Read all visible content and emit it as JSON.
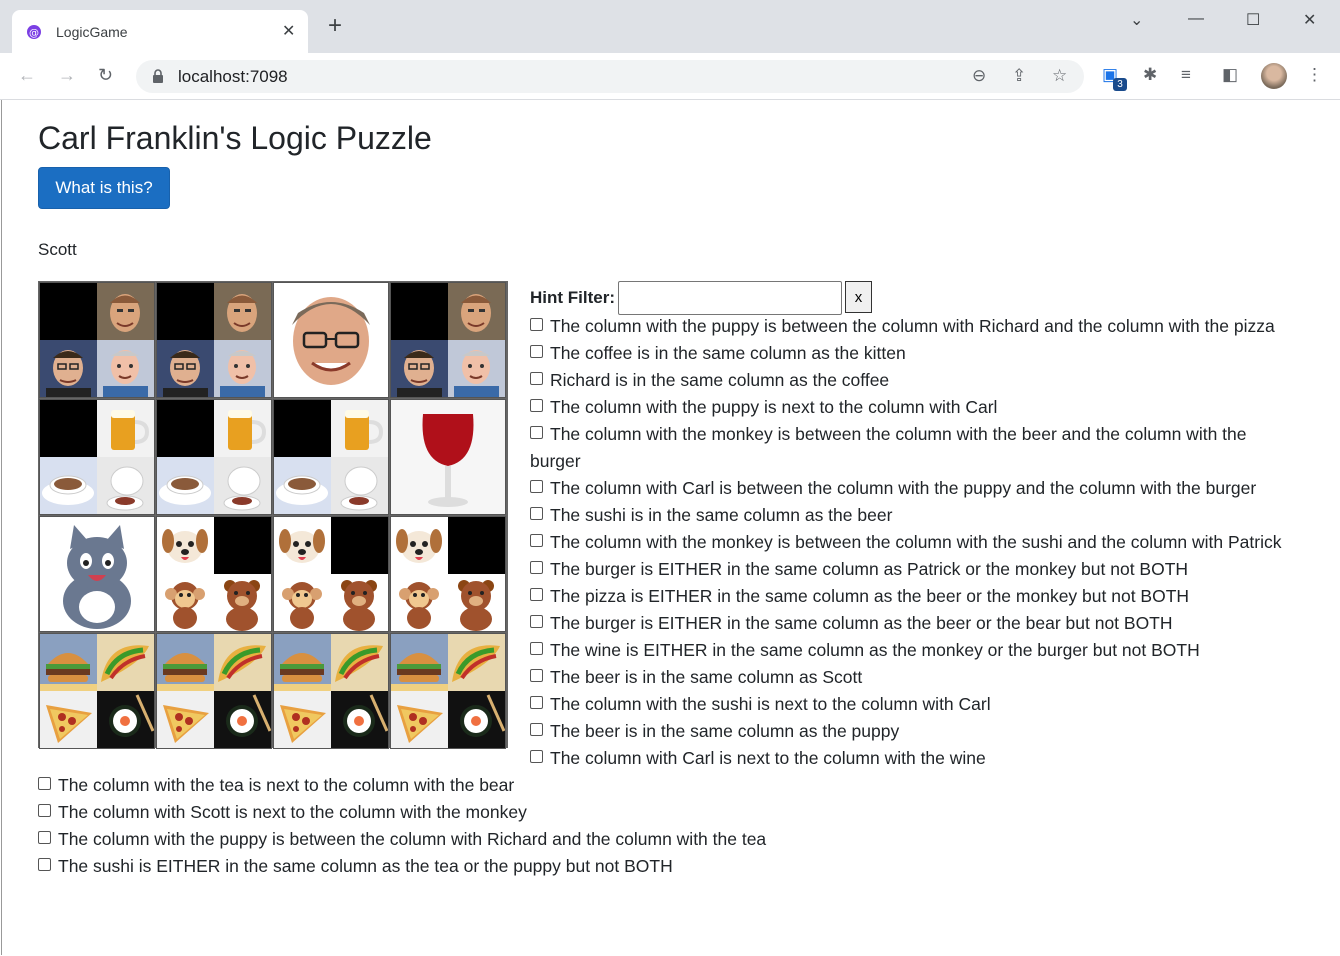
{
  "browser": {
    "tab_title": "LogicGame",
    "url": "localhost:7098",
    "extension_badge": "3"
  },
  "page": {
    "title": "Carl Franklin's Logic Puzzle",
    "what_button": "What is this?",
    "player": "Scott",
    "hint_filter_label": "Hint Filter:",
    "hint_filter_value": "",
    "hint_clear_button": "x"
  },
  "grid": {
    "rows": [
      [
        "person-options",
        "person-options",
        "person-solved-carl",
        "person-options"
      ],
      [
        "drink-options",
        "drink-options",
        "drink-options",
        "drink-solved-wine"
      ],
      [
        "animal-solved-kitten",
        "animal-options",
        "animal-options",
        "animal-options"
      ],
      [
        "food-options",
        "food-options",
        "food-options",
        "food-options"
      ]
    ]
  },
  "clues": [
    "The column with the puppy is between the column with Richard and the column with the pizza",
    "The coffee is in the same column as the kitten",
    "Richard is in the same column as the coffee",
    "The column with the puppy is next to the column with Carl",
    "The column with the monkey is between the column with the beer and the column with the",
    "burger",
    "The column with Carl is between the column with the puppy and the column with the burger",
    "The sushi is in the same column as the beer",
    "The column with the monkey is between the column with the sushi and the column with Patrick",
    "The burger is EITHER in the same column as Patrick or the monkey but not BOTH",
    "The pizza is EITHER in the same column as the beer or the monkey but not BOTH",
    "The burger is EITHER in the same column as the beer or the bear but not BOTH",
    "The wine is EITHER in the same column as the monkey or the burger but not BOTH",
    "The beer is in the same column as Scott",
    "The column with the sushi is next to the column with Carl",
    "The beer is in the same column as the puppy",
    "The column with Carl is next to the column with the wine",
    "The column with the tea is next to the column with the bear",
    "The column with Scott is next to the column with the monkey",
    "The column with the puppy is between the column with Richard and the column with the tea",
    "The sushi is EITHER in the same column as the tea or the puppy but not BOTH"
  ]
}
